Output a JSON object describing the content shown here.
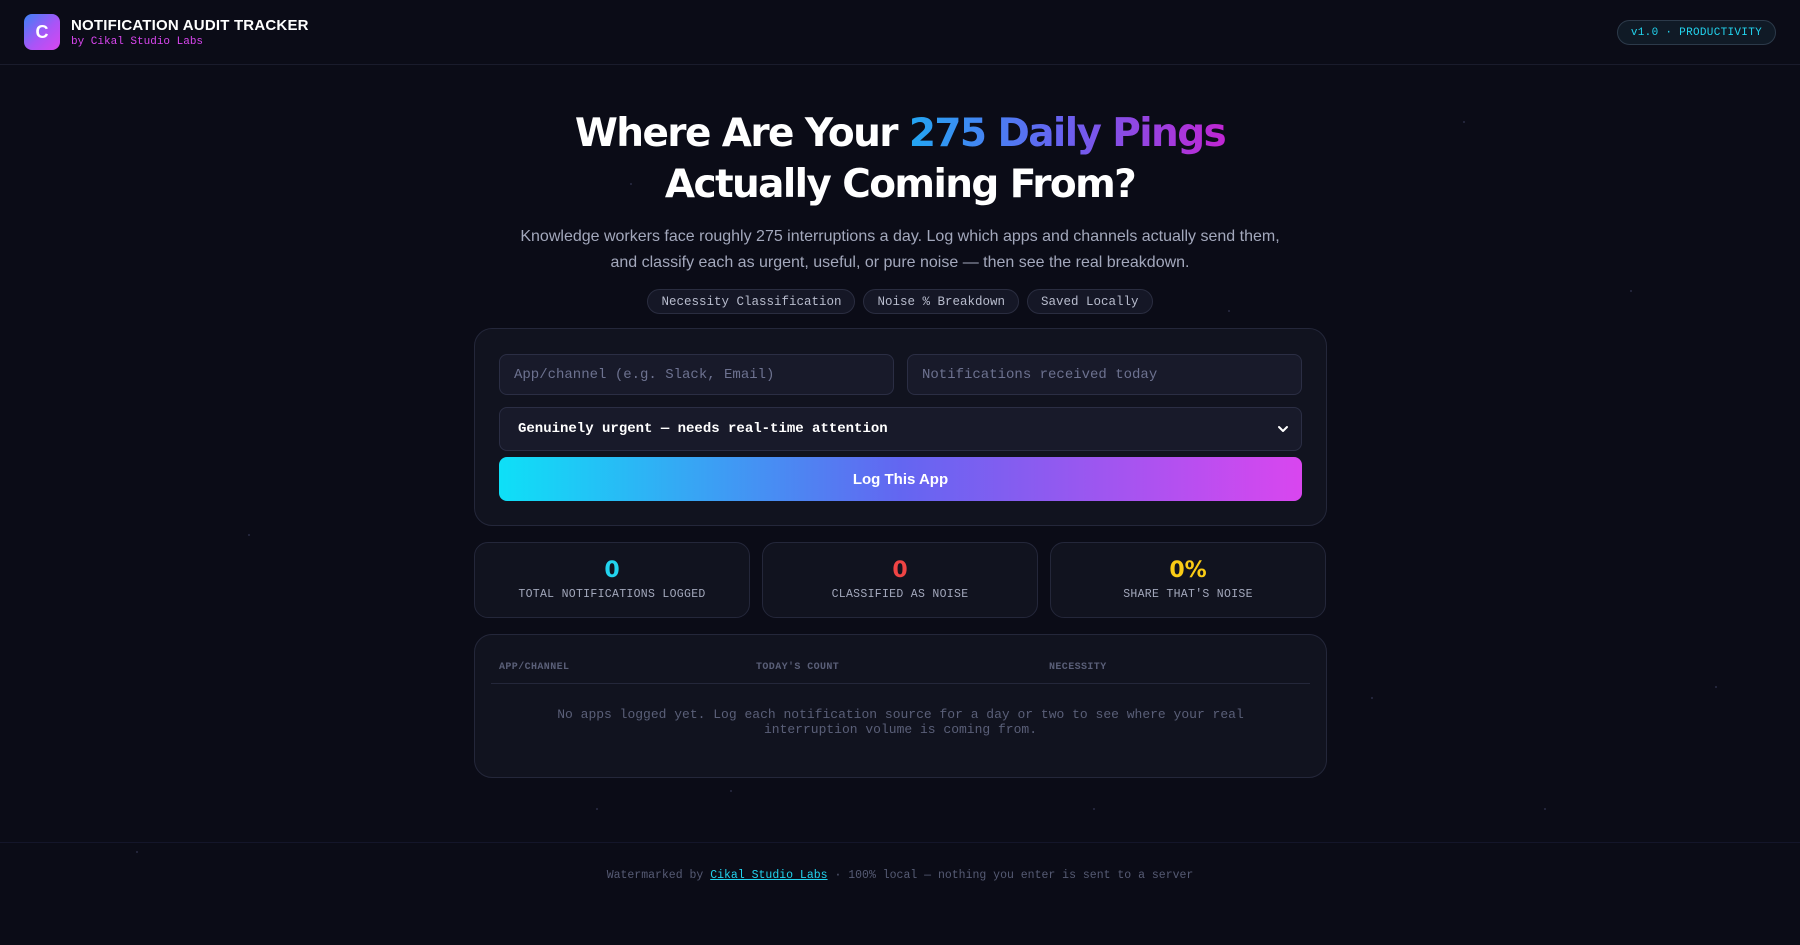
{
  "header": {
    "logo_letter": "C",
    "title": "NOTIFICATION AUDIT TRACKER",
    "subtitle": "by Cikal Studio Labs",
    "version_badge": "v1.0 · PRODUCTIVITY"
  },
  "hero": {
    "title_part1": "Where Are Your ",
    "title_highlight": "275 Daily Pings",
    "title_part2": " Actually Coming From?",
    "description": "Knowledge workers face roughly 275 interruptions a day. Log which apps and channels actually send them, and classify each as urgent, useful, or pure noise — then see the real breakdown.",
    "tags": [
      "Necessity Classification",
      "Noise % Breakdown",
      "Saved Locally"
    ]
  },
  "form": {
    "app_placeholder": "App/channel (e.g. Slack, Email)",
    "count_placeholder": "Notifications received today",
    "necessity_selected": "Genuinely urgent — needs real-time attention",
    "submit_label": "Log This App"
  },
  "stats": {
    "total": {
      "value": "0",
      "label": "TOTAL NOTIFICATIONS LOGGED",
      "color": "#22d3ee"
    },
    "noise": {
      "value": "0",
      "label": "CLASSIFIED AS NOISE",
      "color": "#ef4444"
    },
    "share": {
      "value": "0%",
      "label": "SHARE THAT'S NOISE",
      "color": "#facc15"
    }
  },
  "table": {
    "columns": [
      "APP/CHANNEL",
      "TODAY'S COUNT",
      "NECESSITY"
    ],
    "empty_message": "No apps logged yet. Log each notification source for a day or two to see where your real interruption volume is coming from."
  },
  "footer": {
    "prefix": "Watermarked by ",
    "link_text": "Cikal Studio Labs",
    "suffix": " · 100% local — nothing you enter is sent to a server"
  }
}
